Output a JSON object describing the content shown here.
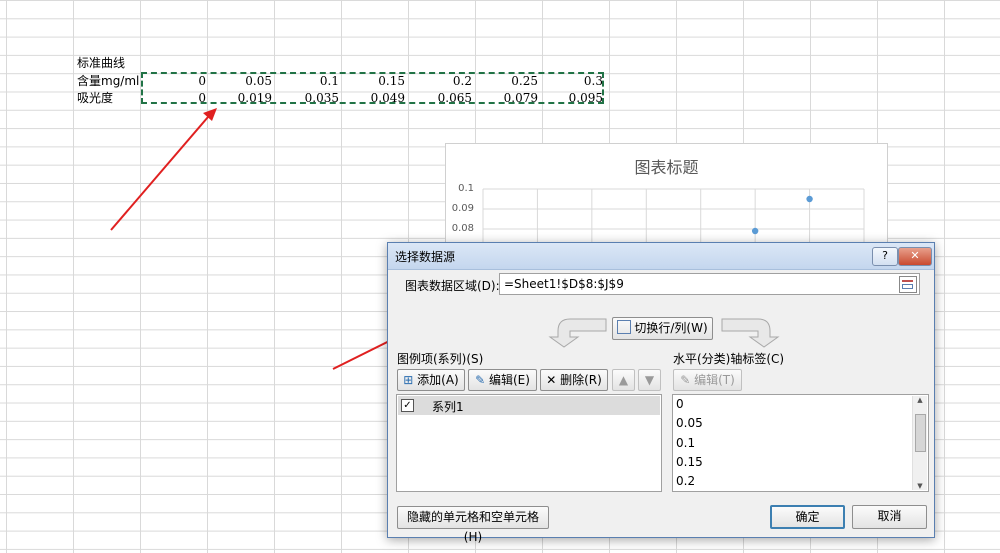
{
  "sheet": {
    "title_cell": "标准曲线",
    "row_content": {
      "label": "含量mg/ml",
      "values": [
        "0",
        "0.05",
        "0.1",
        "0.15",
        "0.2",
        "0.25",
        "0.3"
      ]
    },
    "row_absorbance": {
      "label": "吸光度",
      "values": [
        "0",
        "0.019",
        "0.035",
        "0.049",
        "0.065",
        "0.079",
        "0.095"
      ]
    }
  },
  "chart": {
    "title": "图表标题",
    "yticks": [
      "0.1",
      "0.09",
      "0.08"
    ]
  },
  "chart_data": {
    "type": "scatter",
    "title": "图表标题",
    "x": [
      0,
      0.05,
      0.1,
      0.15,
      0.2,
      0.25,
      0.3
    ],
    "series": [
      {
        "values": [
          0,
          0.019,
          0.035,
          0.049,
          0.065,
          0.079,
          0.095
        ]
      }
    ],
    "ylim": [
      0.08,
      0.1
    ]
  },
  "dialog": {
    "title": "选择数据源",
    "help": "?",
    "close": "✕",
    "range_label": "图表数据区域(D):",
    "range_value": "=Sheet1!$D$8:$J$9",
    "switch_button": "切换行/列(W)",
    "legend_section": "图例项(系列)(S)",
    "add_button": "添加(A)",
    "edit_button": "编辑(E)",
    "delete_button": "删除(R)",
    "series_items": [
      "系列1"
    ],
    "axis_section": "水平(分类)轴标签(C)",
    "axis_edit_button": "编辑(T)",
    "axis_items": [
      "0",
      "0.05",
      "0.1",
      "0.15",
      "0.2"
    ],
    "hidden_cells_button": "隐藏的单元格和空单元格(H)",
    "ok_button": "确定",
    "cancel_button": "取消"
  },
  "colors": {
    "marquee": "#217346",
    "marker": "#5b9bd5",
    "annotation_arrow": "#e02020"
  }
}
